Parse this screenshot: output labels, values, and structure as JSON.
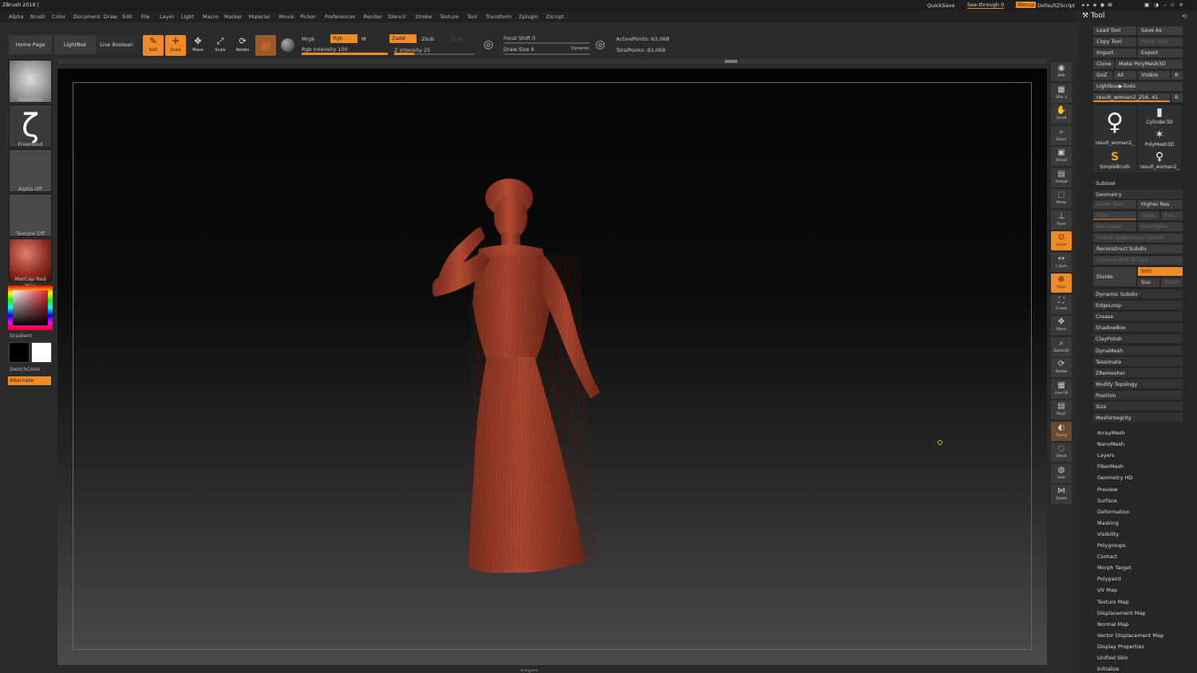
{
  "app": {
    "title": "ZBrush 2018 ["
  },
  "topbar": {
    "quicksave": "QuickSave",
    "seethrough": "See-through 0",
    "menus": "Menus",
    "script": "DefaultZScript"
  },
  "menu": [
    "Alpha",
    "Brush",
    "Color",
    "Document",
    "Draw",
    "Edit",
    "File",
    "Layer",
    "Light",
    "Macro",
    "Marker",
    "Material",
    "Movie",
    "Picker",
    "Preferences",
    "Render",
    "Stencil",
    "Stroke",
    "Texture",
    "Tool",
    "Transform",
    "Zplugin",
    "Zscript"
  ],
  "toolbar": {
    "home_page": "Home Page",
    "lightbox": "LightBox",
    "live_boolean": "Live Boolean",
    "edit": "Edit",
    "draw": "Draw",
    "move": "Move",
    "scale": "Scale",
    "rotate": "Rotate",
    "mrgb": "Mrgb",
    "rgb": "Rgb",
    "m": "M",
    "zadd": "Zadd",
    "zsub": "Zsub",
    "zcut": "Zcut",
    "rgb_intensity": "Rgb Intensity 100",
    "z_intensity": "Z Intensity 25",
    "focal_shift": "Focal Shift 0",
    "draw_size": "Draw Size 6",
    "dynamic": "Dynamic",
    "active_points": "ActivePoints: 63,068",
    "total_points": "TotalPoints: 63,068",
    "rgb_intensity_value": 100,
    "z_intensity_value": 25
  },
  "left_shelf": {
    "brush": "MaskPen",
    "stroke": "FreeHand",
    "alpha": "Alpha Off",
    "texture": "Texture Off",
    "material": "MatCap Red Wax",
    "gradient": "Gradient",
    "switch_color": "SwitchColor",
    "alternate": "Alternate"
  },
  "right_shelf": [
    "BPR",
    "SPix 3",
    "Scroll",
    "Zoom",
    "Actual",
    "AAHalf",
    "Persp",
    "Floor",
    "Local",
    "L.Sym",
    "Qxyz",
    "Frame",
    "Move",
    "Zoom3D",
    "Rotate",
    "Line Fill",
    "PolyF",
    "Transp",
    "Ghost",
    "Solo",
    "Xpose"
  ],
  "palette": {
    "title": "Tool",
    "load_tool": "Load Tool",
    "save_as": "Save As",
    "copy_tool": "Copy Tool",
    "paste_tool": "Paste Tool",
    "import": "Import",
    "export": "Export",
    "clone": "Clone",
    "make_polymesh": "Make PolyMesh3D",
    "goz": "GoZ",
    "all": "All",
    "visible": "Visible",
    "r": "R",
    "lightbox_tools": "Lightbox▶Tools",
    "current_tool": "result_woman2_256. 41",
    "tiles": [
      "result_woman2_",
      "Cylinder3D",
      "PolyMesh3D",
      "SimpleBrush",
      "result_woman2_"
    ],
    "subtool": "Subtool",
    "geometry": "Geometry",
    "lower_res": "Lower Res",
    "higher_res": "Higher Res",
    "sdiv": "SDiv",
    "cage": "Cage",
    "rstr": "Rstr",
    "del_lower": "Del Lower",
    "del_higher": "Del Higher",
    "freeze": "Freeze SubDivision Levels",
    "reconstruct": "Reconstruct Subdiv",
    "convert_bpr": "Convert BPR To Geo",
    "divide": "Divide",
    "smt": "Smt",
    "suv": "Suv",
    "reuv": "ReUV",
    "geometry_items": [
      "Dynamic Subdiv",
      "EdgeLoop",
      "Crease",
      "ShadowBox",
      "ClayPolish",
      "DynaMesh",
      "Tessimate",
      "ZRemesher",
      "Modify Topology",
      "Position",
      "Size",
      "MeshIntegrity"
    ],
    "sections": [
      "ArrayMesh",
      "NanoMesh",
      "Layers",
      "FiberMesh",
      "Geometry HD",
      "Preview",
      "Surface",
      "Deformation",
      "Masking",
      "Visibility",
      "Polygroups",
      "Contact",
      "Morph Target",
      "Polypaint",
      "UV Map",
      "Texture Map",
      "Displacement Map",
      "Normal Map",
      "Vector Displacement Map",
      "Display Properties",
      "Unified Skin",
      "Initialize"
    ]
  },
  "colors": {
    "accent": "#f08a24",
    "model": "#a4412c"
  }
}
